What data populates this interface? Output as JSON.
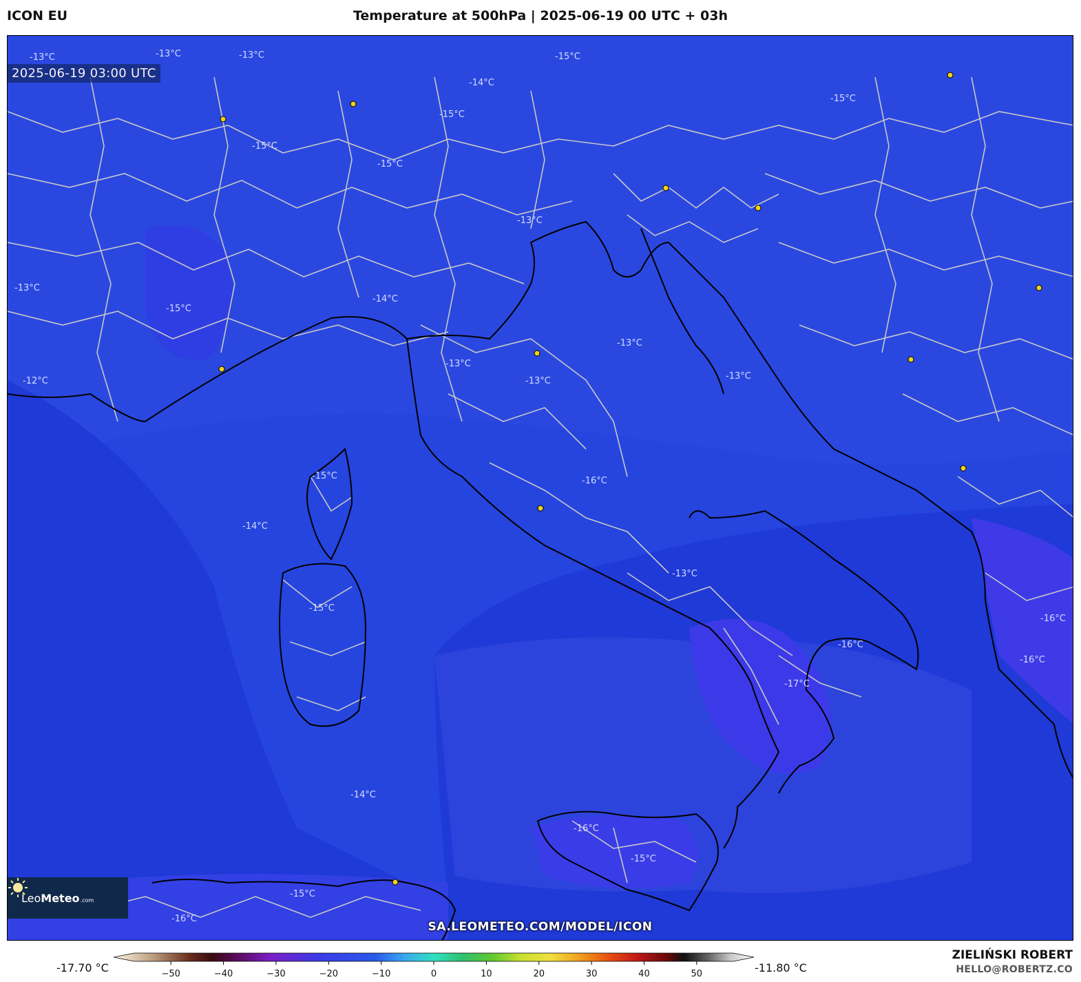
{
  "header": {
    "model_name": "ICON EU",
    "title": "Temperature at 500hPa | 2025-06-19 00 UTC + 03h"
  },
  "map": {
    "valid_time": "2025-06-19 03:00 UTC",
    "source_url": "SA.LEOMETEO.COM/MODEL/ICON",
    "logo": {
      "brand_light": "Leo",
      "brand_bold": "Meteo",
      "brand_suffix": ".com"
    },
    "contour_labels": [
      "-13°C",
      "-13°C",
      "-13°C",
      "-14°C",
      "-15°C",
      "-15°C",
      "-15°C",
      "-15°C",
      "-15°C",
      "-13°C",
      "-13°C",
      "-14°C",
      "-15°C",
      "-12°C",
      "-13°C",
      "-13°C",
      "-13°C",
      "-15°C",
      "-14°C",
      "-16°C",
      "-15°C",
      "-16°C",
      "-17°C",
      "-16°C",
      "-14°C",
      "-16°C",
      "-15°C",
      "-16°C",
      "-15°C",
      "-16°C",
      "-13°C",
      "-13°C"
    ],
    "colors": {
      "sea_dark": "#1f3ad6",
      "sea_light": "#2a4ae2",
      "cold_pocket": "#3b3ae8",
      "borders": "#c8c8c8",
      "coastline": "#000000",
      "city_marker": "#f2d21b"
    }
  },
  "legend": {
    "min_label": "-17.70 °C",
    "max_label": "-11.80 °C",
    "ticks": [
      "−50",
      "−40",
      "−30",
      "−20",
      "−10",
      "0",
      "10",
      "20",
      "30",
      "40",
      "50"
    ],
    "tick_values": [
      -50,
      -40,
      -30,
      -20,
      -10,
      0,
      10,
      20,
      30,
      40,
      50
    ],
    "range": [
      -55,
      55
    ],
    "color_stops": [
      {
        "v": -55,
        "c": "#fff8e6"
      },
      {
        "v": -48,
        "c": "#b89a7a"
      },
      {
        "v": -42,
        "c": "#6b2e1e"
      },
      {
        "v": -38,
        "c": "#3a0a10"
      },
      {
        "v": -34,
        "c": "#5a0a5a"
      },
      {
        "v": -28,
        "c": "#7a1ec8"
      },
      {
        "v": -20,
        "c": "#3a3ae6"
      },
      {
        "v": -10,
        "c": "#2a5ae8"
      },
      {
        "v": -5,
        "c": "#3aa8f0"
      },
      {
        "v": 0,
        "c": "#30e0c0"
      },
      {
        "v": 5,
        "c": "#30c070"
      },
      {
        "v": 10,
        "c": "#60c830"
      },
      {
        "v": 15,
        "c": "#c8e030"
      },
      {
        "v": 20,
        "c": "#f0e040"
      },
      {
        "v": 25,
        "c": "#f0a020"
      },
      {
        "v": 30,
        "c": "#e85010"
      },
      {
        "v": 35,
        "c": "#c01818"
      },
      {
        "v": 40,
        "c": "#6a0808"
      },
      {
        "v": 43,
        "c": "#101010"
      },
      {
        "v": 47,
        "c": "#606060"
      },
      {
        "v": 51,
        "c": "#c8c8c8"
      },
      {
        "v": 55,
        "c": "#ffffff"
      }
    ]
  },
  "credits": {
    "author": "ZIELIŃSKI ROBERT",
    "email": "HELLO@ROBERTZ.CO"
  }
}
